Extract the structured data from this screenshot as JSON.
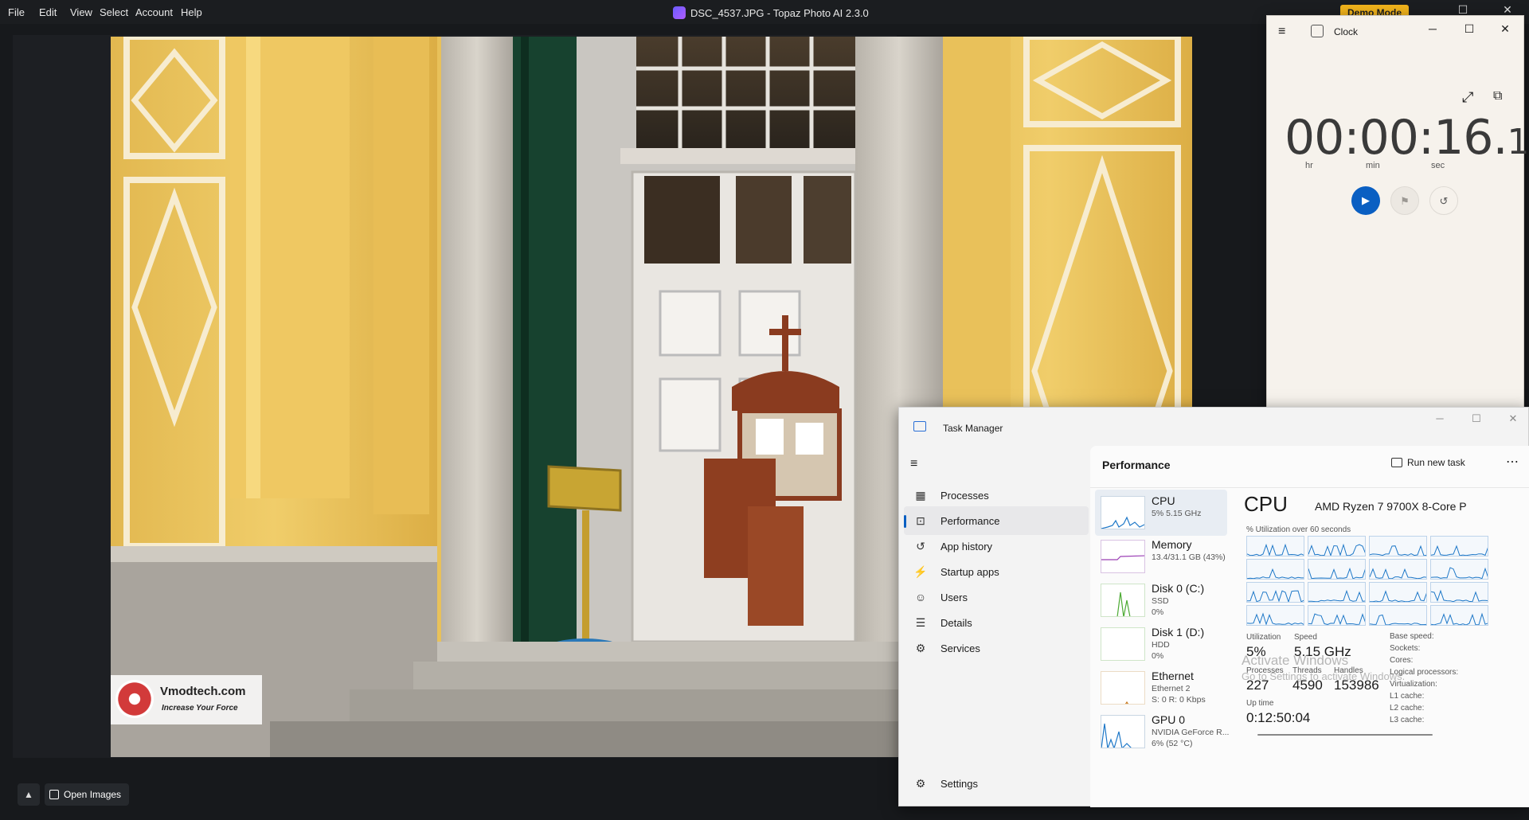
{
  "topaz": {
    "menu": [
      "File",
      "Edit",
      "View",
      "Select",
      "Account",
      "Help"
    ],
    "title": "DSC_4537.JPG - Topaz Photo AI 2.3.0",
    "demo_badge": "Demo Mode",
    "open_images_label": "Open Images",
    "watermark_brand": "Vmodtech.com",
    "watermark_tagline": "Increase Your Force"
  },
  "clock": {
    "title": "Clock",
    "time_main": "00:00:16.",
    "time_centis": "16",
    "units": [
      "hr",
      "min",
      "sec"
    ],
    "accent": "#0a5fc2"
  },
  "taskmgr": {
    "title": "Task Manager",
    "nav": [
      {
        "label": "Processes",
        "icon": "processes-icon"
      },
      {
        "label": "Performance",
        "icon": "performance-icon",
        "active": true
      },
      {
        "label": "App history",
        "icon": "history-icon"
      },
      {
        "label": "Startup apps",
        "icon": "startup-icon"
      },
      {
        "label": "Users",
        "icon": "users-icon"
      },
      {
        "label": "Details",
        "icon": "details-icon"
      },
      {
        "label": "Services",
        "icon": "services-icon"
      }
    ],
    "settings_label": "Settings",
    "performance_title": "Performance",
    "run_new_task": "Run new task",
    "resources": [
      {
        "name": "CPU",
        "sub1": "5%  5.15 GHz",
        "sub2": ""
      },
      {
        "name": "Memory",
        "sub1": "13.4/31.1 GB (43%)",
        "sub2": ""
      },
      {
        "name": "Disk 0 (C:)",
        "sub1": "SSD",
        "sub2": "0%"
      },
      {
        "name": "Disk 1 (D:)",
        "sub1": "HDD",
        "sub2": "0%"
      },
      {
        "name": "Ethernet",
        "sub1": "Ethernet 2",
        "sub2": "S: 0  R: 0 Kbps"
      },
      {
        "name": "GPU 0",
        "sub1": "NVIDIA GeForce R...",
        "sub2": "6%  (52 °C)"
      }
    ],
    "cpu": {
      "heading": "CPU",
      "model": "AMD Ryzen 7 9700X 8-Core P",
      "util_caption": "% Utilization over 60 seconds",
      "utilization_label": "Utilization",
      "utilization": "5%",
      "speed_label": "Speed",
      "speed": "5.15 GHz",
      "processes_label": "Processes",
      "processes": "227",
      "threads_label": "Threads",
      "threads": "4590",
      "handles_label": "Handles",
      "handles": "153986",
      "uptime_label": "Up time",
      "uptime": "0:12:50:04",
      "specs": [
        "Base speed:",
        "Sockets:",
        "Cores:",
        "Logical processors:",
        "Virtualization:",
        "L1 cache:",
        "L2 cache:",
        "L3 cache:"
      ]
    },
    "activate_title": "Activate Windows",
    "activate_sub": "Go to Settings to activate Windows."
  }
}
